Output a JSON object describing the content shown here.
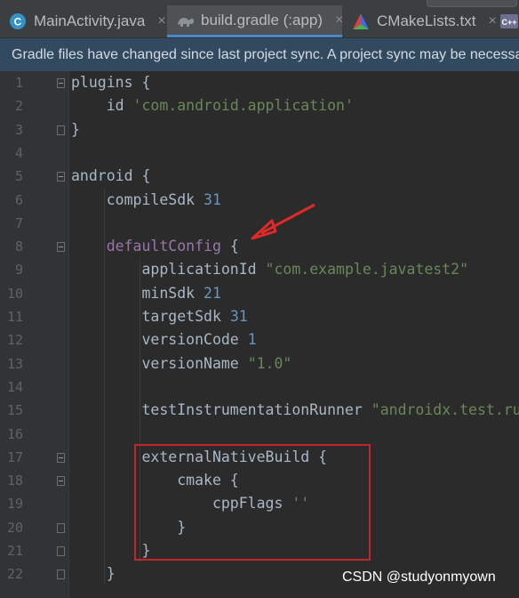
{
  "tabs": [
    {
      "label": "MainActivity.java",
      "icon": "java-class-icon",
      "active": false
    },
    {
      "label": "build.gradle (:app)",
      "icon": "gradle-icon",
      "active": true
    },
    {
      "label": "CMakeLists.txt",
      "icon": "cmake-icon",
      "active": false
    }
  ],
  "tab_close_glyph": "×",
  "banner": {
    "text": "Gradle files have changed since last project sync. A project sync may be necessary for the IDE to work properly."
  },
  "lines": [
    {
      "n": "1",
      "segs": [
        {
          "t": "plugins {"
        }
      ]
    },
    {
      "n": "2",
      "segs": [
        {
          "t": "    id "
        },
        {
          "t": "'com.android.application'",
          "c": "str"
        }
      ]
    },
    {
      "n": "3",
      "segs": [
        {
          "t": "}"
        }
      ]
    },
    {
      "n": "4",
      "segs": []
    },
    {
      "n": "5",
      "segs": [
        {
          "t": "android {"
        }
      ]
    },
    {
      "n": "6",
      "segs": [
        {
          "t": "    compileSdk "
        },
        {
          "t": "31",
          "c": "num"
        }
      ]
    },
    {
      "n": "7",
      "segs": []
    },
    {
      "n": "8",
      "segs": [
        {
          "t": "    "
        },
        {
          "t": "defaultConfig",
          "c": "kw-purple"
        },
        {
          "t": " {"
        }
      ]
    },
    {
      "n": "9",
      "segs": [
        {
          "t": "        applicationId "
        },
        {
          "t": "\"com.example.javatest2\"",
          "c": "str"
        }
      ]
    },
    {
      "n": "10",
      "segs": [
        {
          "t": "        minSdk "
        },
        {
          "t": "21",
          "c": "num"
        }
      ]
    },
    {
      "n": "11",
      "segs": [
        {
          "t": "        targetSdk "
        },
        {
          "t": "31",
          "c": "num"
        }
      ]
    },
    {
      "n": "12",
      "segs": [
        {
          "t": "        versionCode "
        },
        {
          "t": "1",
          "c": "num"
        }
      ]
    },
    {
      "n": "13",
      "segs": [
        {
          "t": "        versionName "
        },
        {
          "t": "\"1.0\"",
          "c": "str"
        }
      ]
    },
    {
      "n": "14",
      "segs": []
    },
    {
      "n": "15",
      "segs": [
        {
          "t": "        testInstrumentationRunner "
        },
        {
          "t": "\"androidx.test.runner.AndroidJUnitRunner\"",
          "c": "str"
        }
      ]
    },
    {
      "n": "16",
      "segs": []
    },
    {
      "n": "17",
      "segs": [
        {
          "t": "        externalNativeBuild {"
        }
      ]
    },
    {
      "n": "18",
      "segs": [
        {
          "t": "            cmake {"
        }
      ]
    },
    {
      "n": "19",
      "segs": [
        {
          "t": "                cppFlags "
        },
        {
          "t": "''",
          "c": "str"
        }
      ]
    },
    {
      "n": "20",
      "segs": [
        {
          "t": "            }"
        }
      ]
    },
    {
      "n": "21",
      "segs": [
        {
          "t": "        }"
        }
      ]
    },
    {
      "n": "22",
      "segs": [
        {
          "t": "    }"
        }
      ]
    }
  ],
  "fold_markers": [
    {
      "line": "1",
      "state": "open"
    },
    {
      "line": "3",
      "state": "close"
    },
    {
      "line": "5",
      "state": "open"
    },
    {
      "line": "8",
      "state": "open"
    },
    {
      "line": "17",
      "state": "open"
    },
    {
      "line": "18",
      "state": "open"
    },
    {
      "line": "20",
      "state": "close"
    },
    {
      "line": "21",
      "state": "close"
    },
    {
      "line": "22",
      "state": "close"
    }
  ],
  "watermark": "CSDN @studyonmyown",
  "colors": {
    "editor_bg": "#2b2b2b",
    "keyword_purple": "#9876aa",
    "string": "#6a8759",
    "number": "#6897bb",
    "annotation_red": "#c0262a"
  }
}
